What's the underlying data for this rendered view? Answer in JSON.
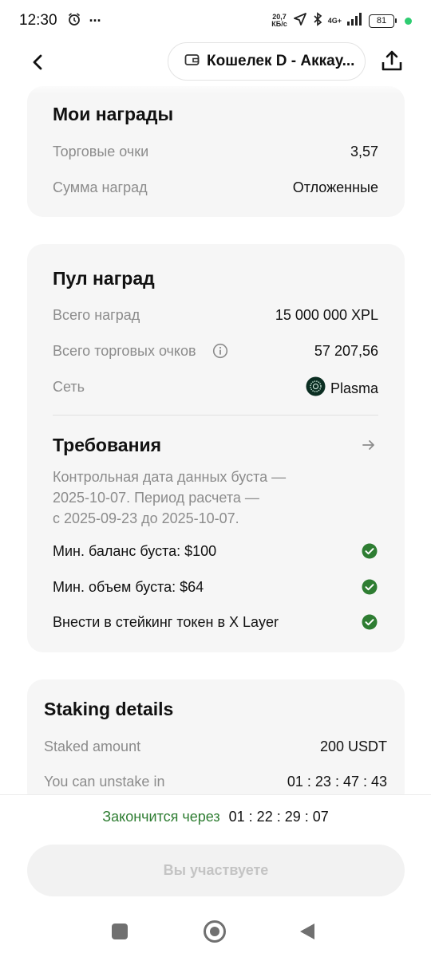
{
  "status_bar": {
    "time": "12:30",
    "more": "···",
    "speed_value": "20,7",
    "speed_unit": "КБ/с",
    "network": "4G+",
    "battery": "81"
  },
  "header": {
    "wallet_label": "Кошелек D - Аккау..."
  },
  "my_rewards": {
    "title": "Мои награды",
    "rows": [
      {
        "label": "Торговые очки",
        "value": "3,57"
      },
      {
        "label": "Сумма наград",
        "value": "Отложенные"
      }
    ]
  },
  "reward_pool": {
    "title": "Пул наград",
    "rows": [
      {
        "label": "Всего наград",
        "value": "15 000 000 XPL"
      },
      {
        "label": "Всего торговых очков",
        "value": "57 207,56"
      },
      {
        "label": "Сеть",
        "value": "Plasma"
      }
    ],
    "requirements": {
      "title": "Требования",
      "description_lines": [
        "Контрольная дата данных буста —",
        "2025-10-07. Период расчета —",
        "с 2025-09-23 до 2025-10-07."
      ],
      "items": [
        {
          "text": "Мин. баланс буста: $100",
          "met": true
        },
        {
          "text": "Мин. объем буста: $64",
          "met": true
        },
        {
          "text": "Внести в стейкинг токен в X Layer",
          "met": true
        }
      ]
    }
  },
  "staking": {
    "title": "Staking details",
    "rows": [
      {
        "label": "Staked amount",
        "value": "200 USDT"
      },
      {
        "label": "You can unstake in",
        "value": "01 : 23 : 47 : 43"
      }
    ]
  },
  "footer": {
    "ends_label": "Закончится через",
    "ends_timer": "01 : 22 : 29 : 07",
    "participate_label": "Вы участвуете"
  },
  "colors": {
    "accent_green": "#2e7d32",
    "check_green": "#2e7d32",
    "card_bg": "#f6f6f6"
  }
}
